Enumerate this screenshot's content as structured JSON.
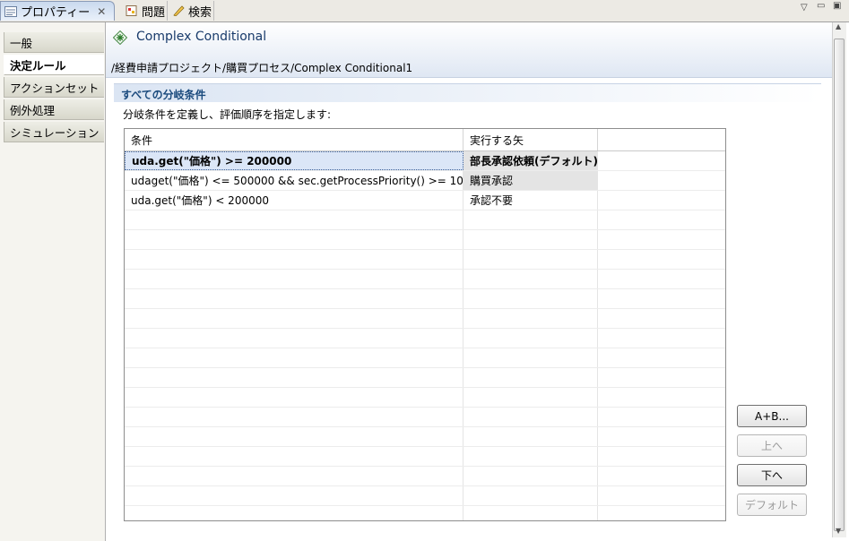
{
  "tabs": [
    {
      "label": "プロパティー",
      "icon": "properties-icon",
      "active": true
    },
    {
      "label": "問題",
      "icon": "problems-icon",
      "active": false
    },
    {
      "label": "検索",
      "icon": "search-icon",
      "active": false
    }
  ],
  "sidebar": {
    "items": [
      {
        "label": "一般"
      },
      {
        "label": "決定ルール",
        "selected": true
      },
      {
        "label": "アクションセット"
      },
      {
        "label": "例外処理"
      },
      {
        "label": "シミュレーション"
      }
    ]
  },
  "header": {
    "title": "Complex Conditional",
    "path": "/経費申請プロジェクト/購買プロセス/Complex Conditional1"
  },
  "section": {
    "title": "すべての分岐条件",
    "description": "分岐条件を定義し、評価順序を指定します:"
  },
  "table": {
    "columns": [
      "条件",
      "実行する矢"
    ],
    "rows": [
      {
        "condition": "uda.get(\"価格\") >= 200000",
        "action": "部長承認依頼(デフォルト)",
        "selected": true
      },
      {
        "condition": "udaget(\"価格\") <= 500000 && sec.getProcessPriority() >= 10",
        "action": "購買承認"
      },
      {
        "condition": "uda.get(\"価格\") < 200000",
        "action": "承認不要"
      }
    ]
  },
  "buttons": {
    "add": "A+B...",
    "up": "上へ",
    "down": "下へ",
    "default": "デフォルト"
  },
  "colors": {
    "accent": "#193b6b",
    "selection": "#dbe6f7"
  }
}
